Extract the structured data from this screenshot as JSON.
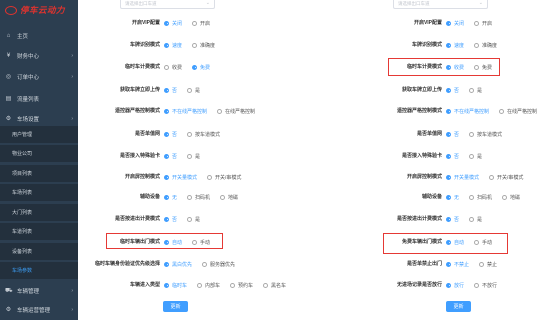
{
  "logo": {
    "text": "停车云动力"
  },
  "menu": [
    {
      "label": "主页",
      "icon": "home-icon",
      "glyph": "⌂",
      "expandable": false
    },
    {
      "label": "财务中心",
      "icon": "finance-icon",
      "glyph": "¥",
      "expandable": true
    },
    {
      "label": "订单中心",
      "icon": "order-icon",
      "glyph": "◎",
      "expandable": true
    },
    {
      "label": "流量列表",
      "icon": "list-icon",
      "glyph": "▤",
      "expandable": false
    },
    {
      "label": "车场设置",
      "icon": "gear-icon",
      "glyph": "⚙",
      "expandable": true
    }
  ],
  "submenu": [
    "用户管理",
    "物业公司",
    "项目列表",
    "车场列表",
    "大门列表",
    "车道列表",
    "设备列表",
    "车场参数"
  ],
  "submenu_active": 7,
  "menu_bottom": [
    {
      "label": "车辆管理",
      "icon": "car-icon",
      "glyph": "⛟",
      "expandable": true
    },
    {
      "label": "车辆运营管理",
      "icon": "settings-icon",
      "glyph": "⚙",
      "expandable": true
    }
  ],
  "left_select_placeholder": "请选择出口车道",
  "right_select_placeholder": "请选择出口车道",
  "left_rows": [
    {
      "label": "开启VIP配置",
      "options": [
        "关闭",
        "开启"
      ],
      "selected": 0
    },
    {
      "label": "车牌识别模式",
      "options": [
        "速度",
        "准确度"
      ],
      "selected": 0
    },
    {
      "label": "临时车计费模式",
      "options": [
        "收费",
        "免费"
      ],
      "selected": 1
    },
    {
      "label": "获取车牌立即上传",
      "options": [
        "否",
        "是"
      ],
      "selected": 0
    },
    {
      "label": "遥控器严格控制模式",
      "options": [
        "不在线严格控制",
        "在线严格控制"
      ],
      "selected": 0
    },
    {
      "label": "是否单值网",
      "options": [
        "否",
        "按车道模式"
      ],
      "selected": 0
    },
    {
      "label": "是否接入特殊验卡",
      "options": [
        "否",
        "是"
      ],
      "selected": 0
    },
    {
      "label": "开启屏控制模式",
      "options": [
        "开关量模式",
        "开关/串模式"
      ],
      "selected": 0
    },
    {
      "label": "辅助设备",
      "options": [
        "无",
        "扫码机",
        "地磁"
      ],
      "selected": 0
    },
    {
      "label": "是否按进出计费模式",
      "options": [
        "否",
        "是"
      ],
      "selected": 0
    },
    {
      "label": "临时车辆出门模式",
      "options": [
        "自动",
        "手动"
      ],
      "selected": 0
    },
    {
      "label": "临时车辆身份验证优先级选择",
      "options": [
        "黑白优先",
        "服务器优先"
      ],
      "selected": 0
    },
    {
      "label": "车辆进入类型",
      "options": [
        "临时车",
        "内部车",
        "预约车",
        "黑名车"
      ],
      "selected": 0
    }
  ],
  "right_rows": [
    {
      "label": "开启VIP配置",
      "options": [
        "关闭",
        "开启"
      ],
      "selected": 0
    },
    {
      "label": "车牌识别模式",
      "options": [
        "速度",
        "准确度"
      ],
      "selected": 0
    },
    {
      "label": "临时车计费模式",
      "options": [
        "收费",
        "免费"
      ],
      "selected": 0
    },
    {
      "label": "获取车牌立即上传",
      "options": [
        "否",
        "是"
      ],
      "selected": 0
    },
    {
      "label": "遥控器严格控制模式",
      "options": [
        "不在线严格控制",
        "在线严格控制"
      ],
      "selected": 0
    },
    {
      "label": "是否单值网",
      "options": [
        "否",
        "按车道模式"
      ],
      "selected": 0
    },
    {
      "label": "是否接入特殊验卡",
      "options": [
        "否",
        "是"
      ],
      "selected": 0
    },
    {
      "label": "开启屏控制模式",
      "options": [
        "开关量模式",
        "开关/串模式"
      ],
      "selected": 0
    },
    {
      "label": "辅助设备",
      "options": [
        "无",
        "扫码机",
        "地磁"
      ],
      "selected": 0
    },
    {
      "label": "是否按进出计费模式",
      "options": [
        "否",
        "是"
      ],
      "selected": 0
    },
    {
      "label": "免费车辆出门模式",
      "options": [
        "自动",
        "手动"
      ],
      "selected": 0
    },
    {
      "label": "是否单禁止出门",
      "options": [
        "不禁止",
        "禁止"
      ],
      "selected": 0
    },
    {
      "label": "无进场记录是否放行",
      "options": [
        "放行",
        "不放行"
      ],
      "selected": 0
    }
  ],
  "save_label": "更新",
  "accent": "#409eff",
  "highlight_color": "#e53935"
}
